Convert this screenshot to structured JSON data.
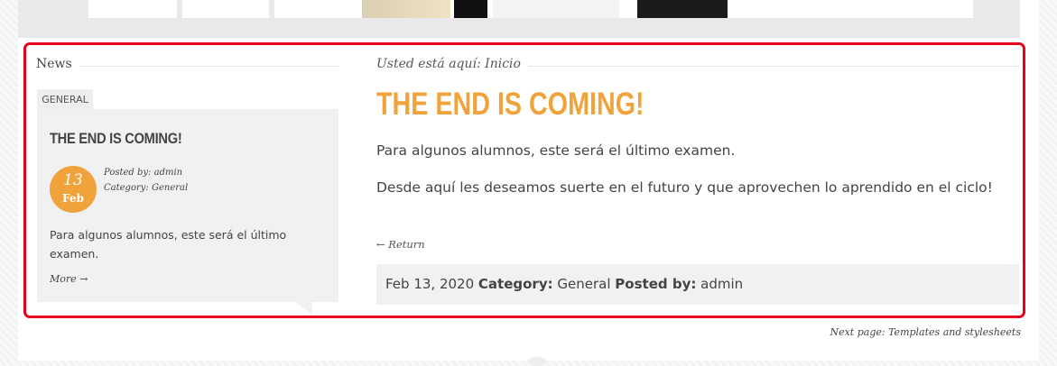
{
  "sidebar": {
    "heading": "News",
    "tab_label": "GENERAL",
    "post": {
      "title": "THE END IS COMING!",
      "date_day": "13",
      "date_month": "Feb",
      "posted_by_label": "Posted by:",
      "posted_by_value": "admin",
      "category_label": "Category:",
      "category_value": "General",
      "excerpt": "Para algunos alumnos, este será el último examen.",
      "more_label": "More →"
    }
  },
  "main": {
    "breadcrumb": "Usted está aquí: Inicio",
    "title": "THE END IS COMING!",
    "paragraphs": [
      "Para algunos alumnos, este será el último examen.",
      "Desde aquí les deseamos suerte en el futuro y que aprovechen lo aprendido en el ciclo!"
    ],
    "return_label": "← Return",
    "footer": {
      "date": "Feb 13, 2020",
      "category_label": "Category:",
      "category_value": "General",
      "posted_by_label": "Posted by:",
      "posted_by_value": "admin"
    }
  },
  "next_page": "Next page: Templates and stylesheets",
  "colors": {
    "accent": "#f0a33b",
    "highlight_border": "#e8001c",
    "panel_bg": "#f1f0f3"
  }
}
